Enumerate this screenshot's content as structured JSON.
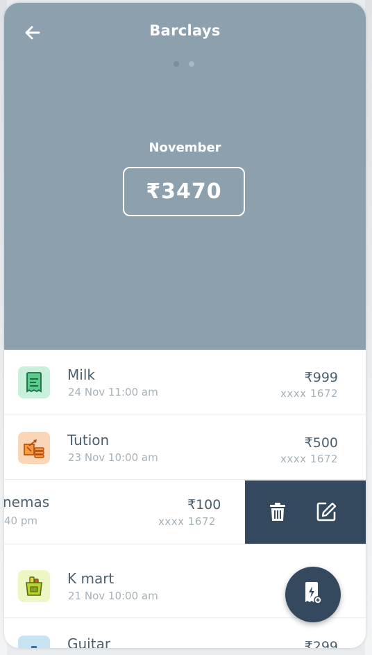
{
  "header": {
    "title": "Barclays",
    "month": "November",
    "total": "₹3470",
    "page_dots": 2,
    "background_color": "#8ca1ad"
  },
  "transactions": [
    {
      "name": "Milk",
      "date": "24 Nov 11:00 am",
      "amount": "₹999",
      "card": "xxxx 1672",
      "icon": "receipt-icon",
      "icon_bg": "#c8f0db"
    },
    {
      "name": "Tution",
      "date": "23 Nov 10:00 am",
      "amount": "₹500",
      "card": "xxxx 1672",
      "icon": "education-icon",
      "icon_bg": "#fbd6b6"
    },
    {
      "name": "nemas",
      "date": "40 pm",
      "amount": "₹100",
      "card": "xxxx 1672",
      "icon": "",
      "icon_bg": ""
    },
    {
      "name": "K mart",
      "date": "21 Nov 10:00 am",
      "amount": "",
      "card": "",
      "icon": "grocery-icon",
      "icon_bg": "#eef7c4"
    },
    {
      "name": "Guitar",
      "date": "",
      "amount": "₹299",
      "card": "",
      "icon": "guitar-icon",
      "icon_bg": "#c5e3f3"
    }
  ],
  "swipe_actions": {
    "delete_icon": "trash-icon",
    "edit_icon": "edit-icon",
    "panel_color": "#34495e"
  },
  "fab": {
    "icon": "add-bill-icon",
    "color": "#34495e"
  }
}
